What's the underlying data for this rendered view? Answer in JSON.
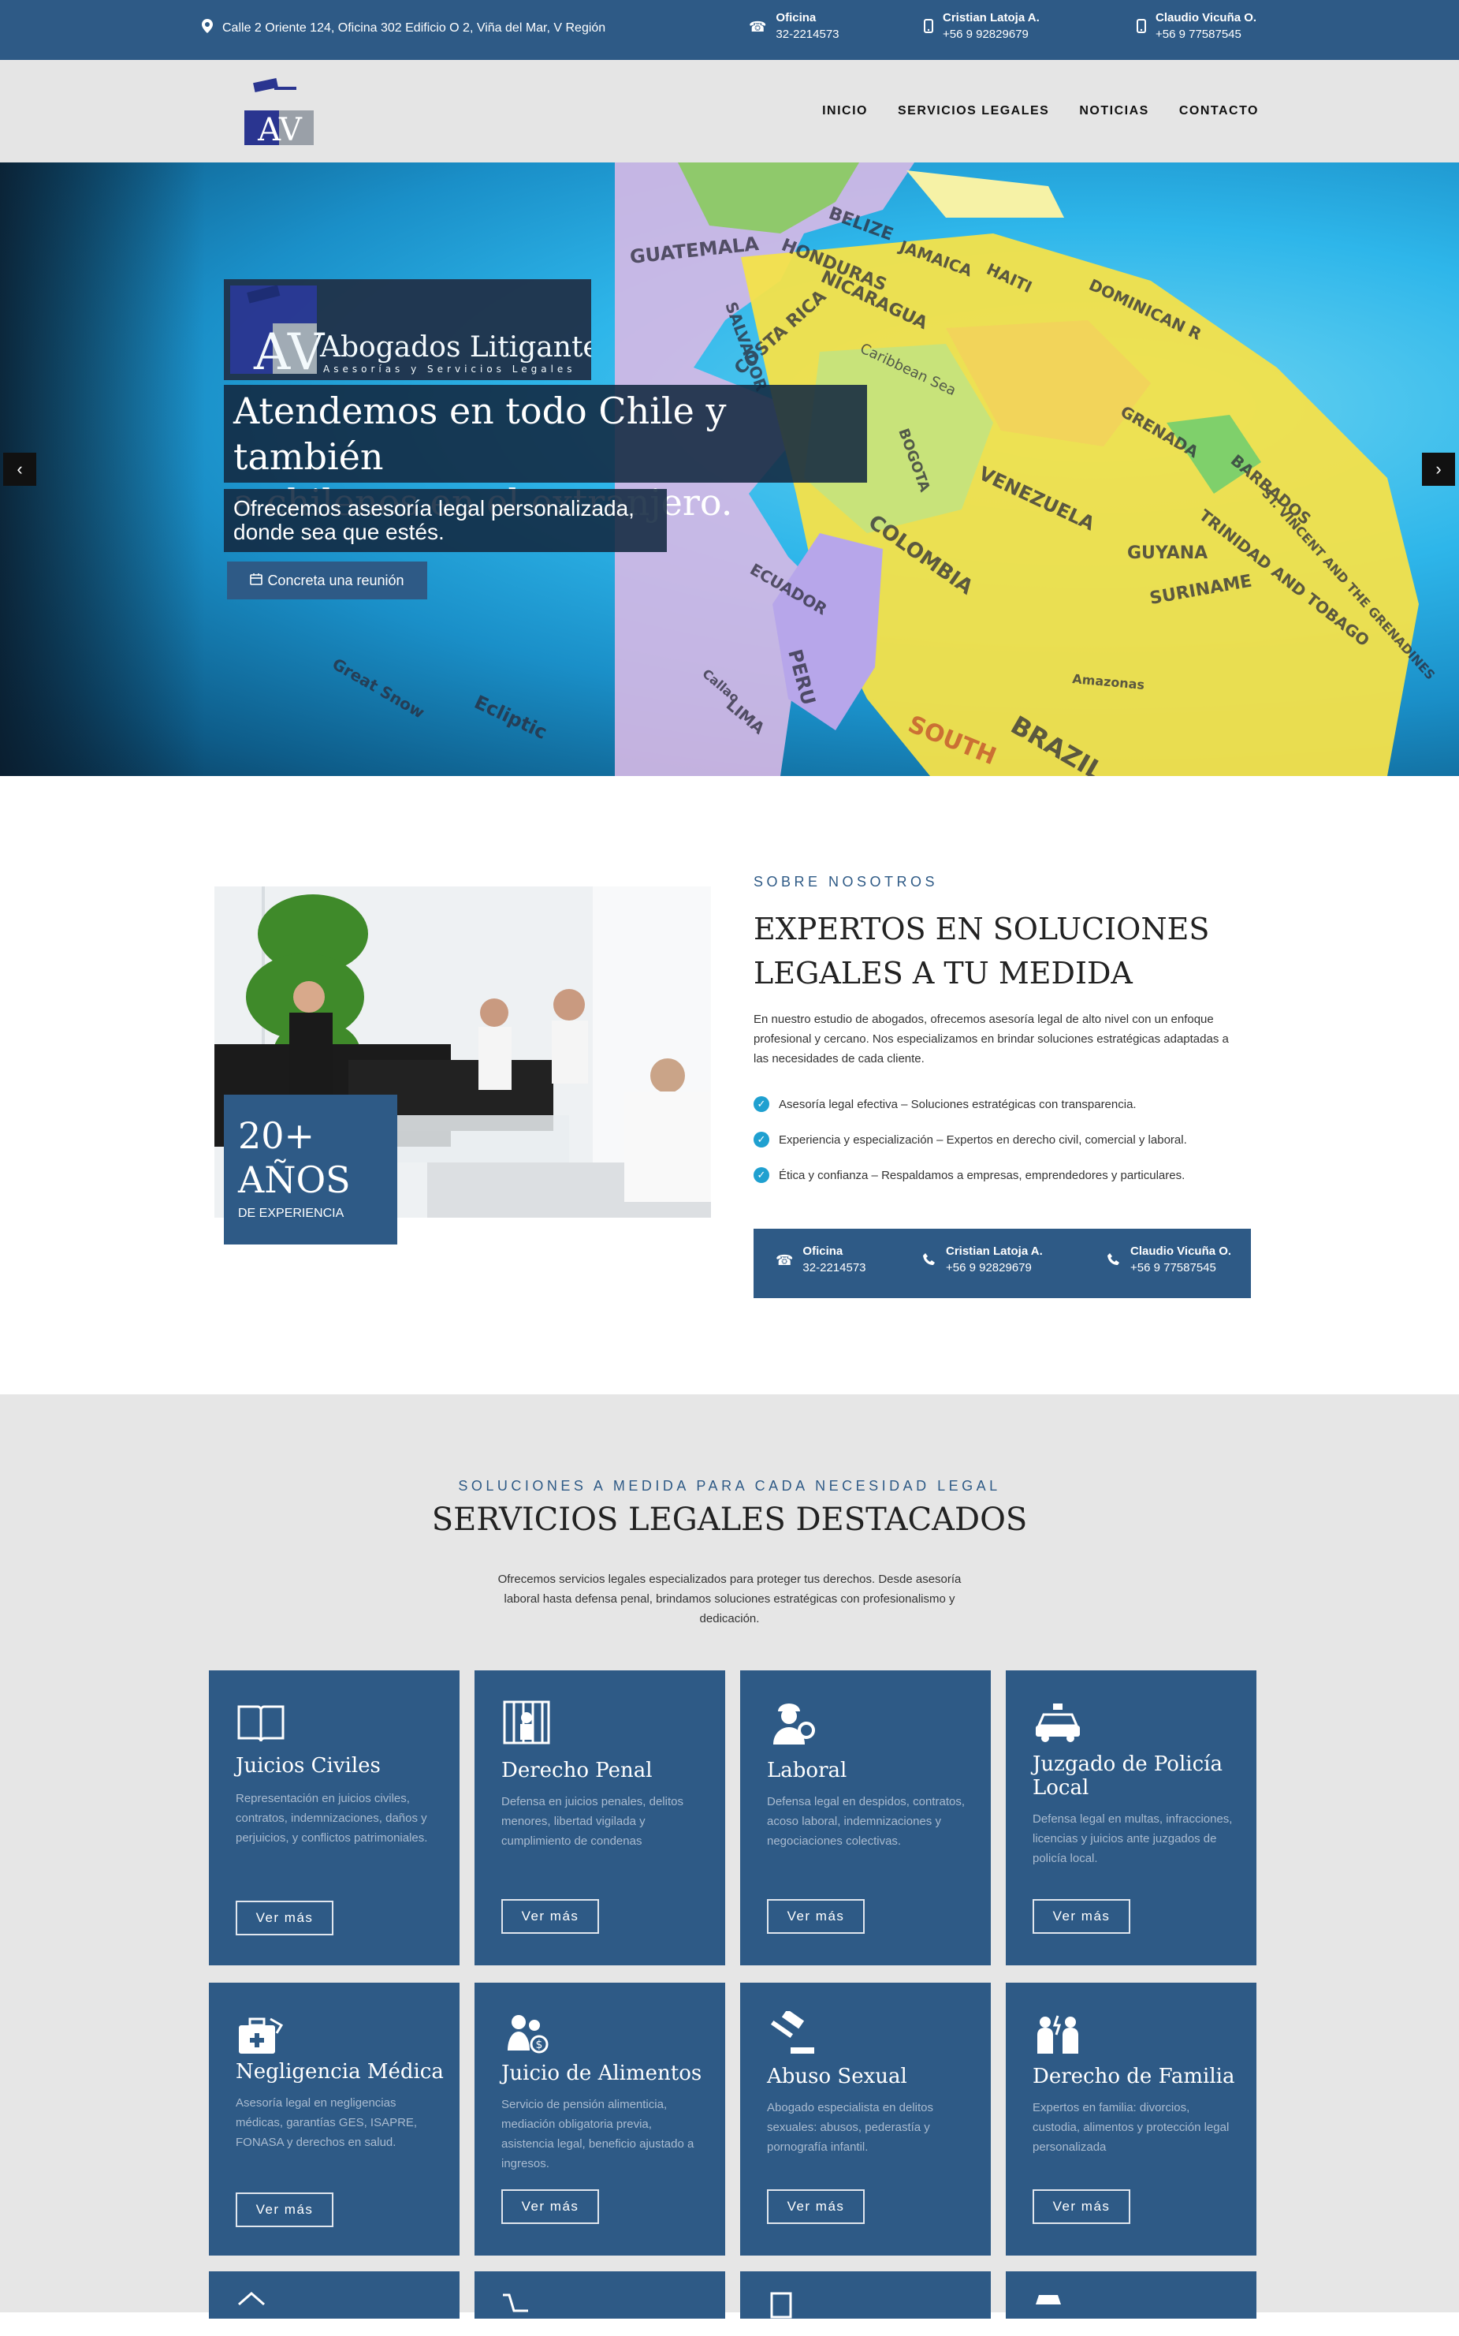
{
  "topbar": {
    "address": "Calle 2 Oriente 124, Oficina 302 Edificio O 2, Viña del Mar, V Región",
    "contacts": [
      {
        "name": "Oficina",
        "phone": "32-2214573"
      },
      {
        "name": "Cristian Latoja A.",
        "phone": "+56 9 92829679"
      },
      {
        "name": "Claudio Vicuña O.",
        "phone": "+56 9 77587545"
      }
    ]
  },
  "header": {
    "logo_text": "AV",
    "nav": [
      "INICIO",
      "SERVICIOS LEGALES",
      "NOTICIAS",
      "CONTACTO"
    ]
  },
  "hero": {
    "logo_text": "AV",
    "logo_title": "Abogados Litigantes",
    "logo_subtitle": "Asesorías y Servicios Legales",
    "headline_line1": "Atendemos en todo Chile y también",
    "headline_line2": "a chilenos en el extranjero.",
    "sub_line1": "Ofrecemos asesoría legal personalizada,",
    "sub_line2": "donde sea que estés.",
    "cta": "Concreta una reunión",
    "map_labels": [
      "GUATEMALA",
      "HONDURAS",
      "NICARAGUA",
      "SALVADOR",
      "COSTA RICA",
      "BELIZE",
      "JAMAICA",
      "HAITI",
      "DOMINICAN R",
      "GRENADA",
      "BARBADOS",
      "ST. VINCENT AND THE GRENADINES",
      "TRINIDAD AND TOBAGO",
      "GUYANA",
      "SURINAME",
      "VENEZUELA",
      "COLOMBIA",
      "BOGOTA",
      "ECUADOR",
      "PERU",
      "LIMA",
      "Callao",
      "BRAZIL",
      "SOUTH",
      "Amazonas",
      "Great Snow",
      "Ecliptic",
      "Caribbean Sea"
    ]
  },
  "about": {
    "kicker": "SOBRE NOSOTROS",
    "title_line1": "EXPERTOS EN SOLUCIONES",
    "title_line2": "LEGALES A TU MEDIDA",
    "paragraph": "En nuestro estudio de abogados, ofrecemos asesoría legal de alto nivel con un enfoque profesional y cercano. Nos especializamos en brindar soluciones estratégicas adaptadas a las necesidades de cada cliente.",
    "checks": [
      "Asesoría legal efectiva – Soluciones estratégicas con transparencia.",
      "Experiencia y especialización – Expertos en derecho civil, comercial y laboral.",
      "Ética y confianza – Respaldamos a empresas, emprendedores y particulares."
    ],
    "badge_big_line1": "20+",
    "badge_big_line2": "AÑOS",
    "badge_small": "DE EXPERIENCIA",
    "contacts": [
      {
        "name": "Oficina",
        "phone": "32-2214573"
      },
      {
        "name": "Cristian Latoja A.",
        "phone": "+56 9 92829679"
      },
      {
        "name": "Claudio Vicuña O.",
        "phone": "+56 9 77587545"
      }
    ]
  },
  "services": {
    "kicker": "SOLUCIONES A MEDIDA PARA CADA NECESIDAD LEGAL",
    "title": "SERVICIOS LEGALES DESTACADOS",
    "intro_line1": "Ofrecemos servicios legales especializados para proteger tus derechos. Desde asesoría",
    "intro_line2": "laboral hasta defensa penal, brindamos soluciones estratégicas con profesionalismo y",
    "intro_line3": "dedicación.",
    "more_label": "Ver más",
    "cards": [
      {
        "title": "Juicios Civiles",
        "icon": "open-book-icon",
        "desc": "Representación en juicios civiles, contratos, indemnizaciones, daños y perjuicios, y conflictos patrimoniales."
      },
      {
        "title": "Derecho Penal",
        "icon": "prison-bars-icon",
        "desc": "Defensa en juicios penales, delitos menores, libertad vigilada y cumplimiento de condenas"
      },
      {
        "title": "Laboral",
        "icon": "worker-icon",
        "desc": "Defensa legal en despidos, contratos, acoso laboral, indemnizaciones y negociaciones colectivas."
      },
      {
        "title": "Juzgado de Policía Local",
        "icon": "police-car-icon",
        "desc": "Defensa legal en multas, infracciones, licencias y juicios ante juzgados de policía local."
      },
      {
        "title": "Negligencia Médica",
        "icon": "medical-kit-icon",
        "desc": "Asesoría legal en negligencias médicas, garantías GES, ISAPRE, FONASA y derechos en salud."
      },
      {
        "title": "Juicio de Alimentos",
        "icon": "family-support-icon",
        "desc": "Servicio de pensión alimenticia, mediación obligatoria previa, asistencia legal, beneficio ajustado a ingresos."
      },
      {
        "title": "Abuso Sexual",
        "icon": "gavel-icon",
        "desc": "Abogado especialista en delitos sexuales: abusos, pederastía y pornografía infantil."
      },
      {
        "title": "Derecho de Familia",
        "icon": "family-icon",
        "desc": "Expertos en familia: divorcios, custodia, alimentos y protección legal personalizada"
      }
    ],
    "partial_icons": [
      "house-icon",
      "cart-icon",
      "document-icon",
      "store-icon"
    ]
  }
}
